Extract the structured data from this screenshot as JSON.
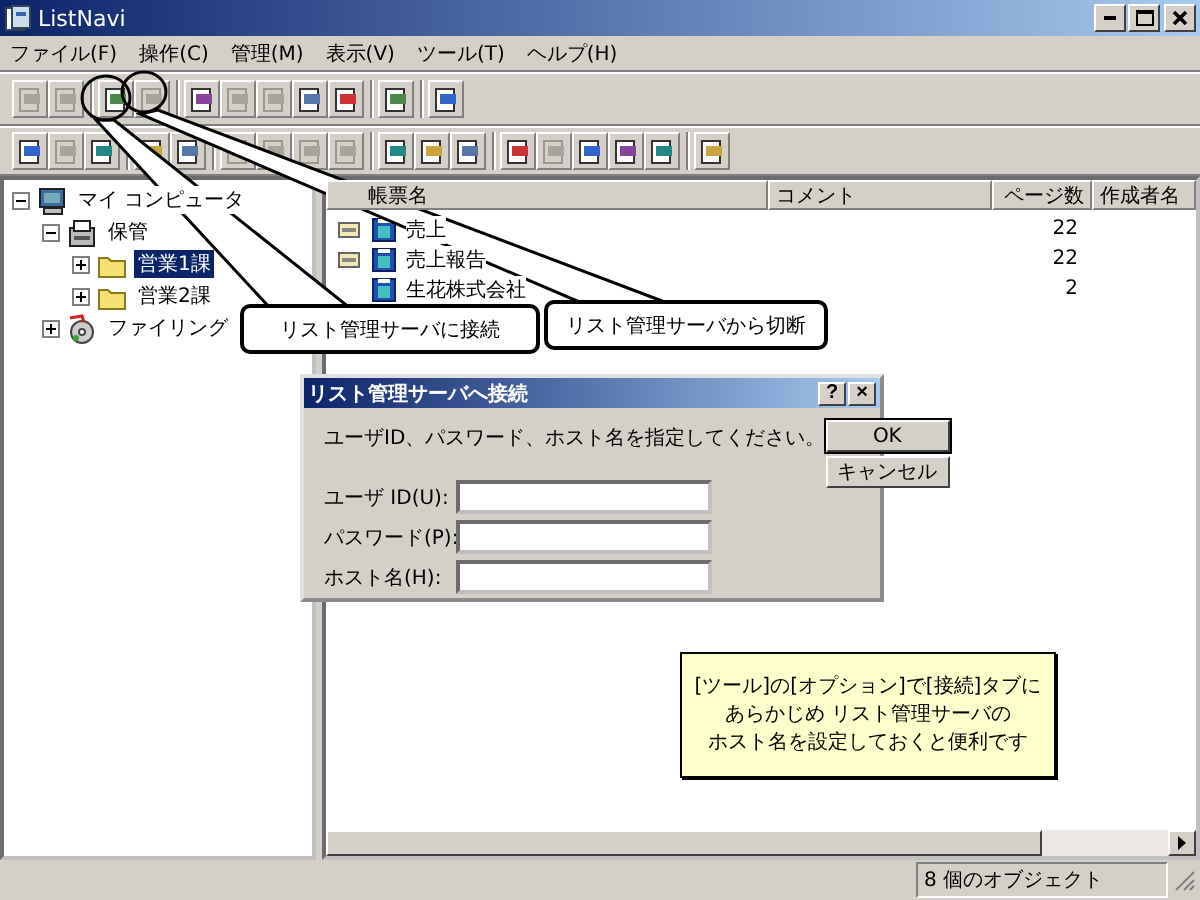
{
  "window": {
    "title": "ListNavi"
  },
  "menu": [
    "ファイル(F)",
    "操作(C)",
    "管理(M)",
    "表示(V)",
    "ツール(T)",
    "ヘルプ(H)"
  ],
  "toolbars": [
    [
      [
        {
          "disabled": true
        },
        {
          "disabled": true
        }
      ],
      [
        {
          "disabled": false
        },
        {
          "disabled": true
        }
      ],
      [
        {
          "disabled": false
        },
        {
          "disabled": true
        },
        {
          "disabled": true
        },
        {
          "disabled": false
        },
        {
          "disabled": false
        }
      ],
      [
        {
          "disabled": false
        }
      ],
      [
        {
          "disabled": false
        }
      ]
    ],
    [
      [
        {
          "disabled": false
        },
        {
          "disabled": true
        },
        {
          "disabled": false
        }
      ],
      [
        {
          "disabled": false
        },
        {
          "disabled": false
        }
      ],
      [
        {
          "disabled": true
        },
        {
          "disabled": true
        },
        {
          "disabled": true
        },
        {
          "disabled": true
        }
      ],
      [
        {
          "disabled": false
        },
        {
          "disabled": false
        },
        {
          "disabled": false
        }
      ],
      [
        {
          "disabled": false
        },
        {
          "disabled": true
        },
        {
          "disabled": false
        },
        {
          "disabled": false
        },
        {
          "disabled": false
        }
      ],
      [
        {
          "disabled": false
        }
      ]
    ]
  ],
  "tree": [
    {
      "label": "マイ コンピュータ",
      "kind": "computer",
      "expanded": true,
      "selected": false,
      "children": [
        {
          "label": "保管",
          "kind": "cabinet",
          "expanded": true,
          "selected": false,
          "children": [
            {
              "label": "営業1課",
              "kind": "folder",
              "expanded": false,
              "selected": true
            },
            {
              "label": "営業2課",
              "kind": "folder",
              "expanded": false,
              "selected": false
            }
          ]
        },
        {
          "label": "ファイリング",
          "kind": "filing",
          "expanded": false,
          "selected": false
        }
      ]
    }
  ],
  "list": {
    "columns": [
      "帳票名",
      "コメント",
      "ページ数",
      "作成者名"
    ],
    "rows": [
      {
        "name": "売上",
        "marked": true,
        "pages": "22"
      },
      {
        "name": "売上報告",
        "marked": true,
        "pages": "22"
      },
      {
        "name": "生花株式会社",
        "marked": false,
        "pages": "2"
      }
    ]
  },
  "status_bar": {
    "text": "8 個のオブジェクト"
  },
  "callouts": [
    {
      "text": "リスト管理サーバに接続"
    },
    {
      "text": "リスト管理サーバから切断"
    }
  ],
  "dialog": {
    "title": "リスト管理サーバへ接続",
    "help": "?",
    "close": "×",
    "prompt": "ユーザID、パスワード、ホスト名を指定してください。",
    "fields": [
      {
        "label": "ユーザ ID(U):"
      },
      {
        "label": "パスワード(P):"
      },
      {
        "label": "ホスト名(H):"
      }
    ],
    "buttons": [
      "OK",
      "キャンセル"
    ]
  },
  "note": {
    "lines": [
      "[ツール]の[オプション]で[接続]タブに",
      "あらかじめ リスト管理サーバの",
      "ホスト名を設定しておくと便利です"
    ]
  }
}
